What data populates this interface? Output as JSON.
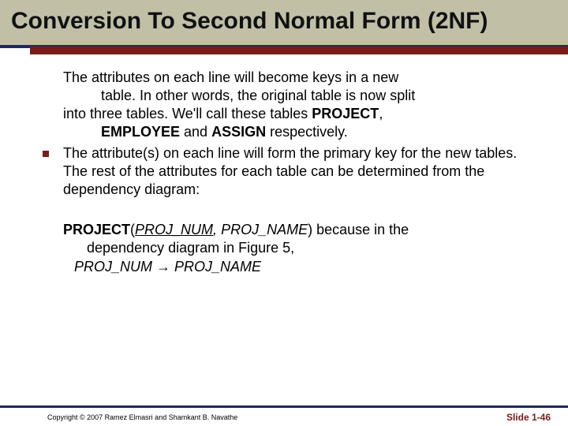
{
  "title": "Conversion To Second Normal Form (2NF)",
  "para1_line1": "The attributes on each line will become keys in a new",
  "para1_line2": "table. In other words, the original table is now split",
  "para1_line3_pre": "into three tables. We'll call these tables ",
  "para1_proj": "PROJECT",
  "para1_sep": ", ",
  "para1_emp": "EMPLOYEE",
  "para1_and": " and ",
  "para1_assign": "ASSIGN",
  "para1_end": " respectively.",
  "bullet_text": "The attribute(s) on each line will form the primary key for the new tables. The rest of the attributes for each table can be determined from the dependency diagram:",
  "def_project_label": "PROJECT",
  "def_open": "(",
  "def_projnum": "PROJ_NUM",
  "def_comma": ", ",
  "def_projname": "PROJ_NAME",
  "def_close_because": ") because  in the",
  "def_line2": "dependency diagram in Figure 5,",
  "def_fd_left": "PROJ_NUM",
  "def_arrow": " → ",
  "def_fd_right": "PROJ_NAME",
  "copyright": "Copyright © 2007 Ramez Elmasri and Shamkant B. Navathe",
  "slidenum": "Slide 1-46"
}
